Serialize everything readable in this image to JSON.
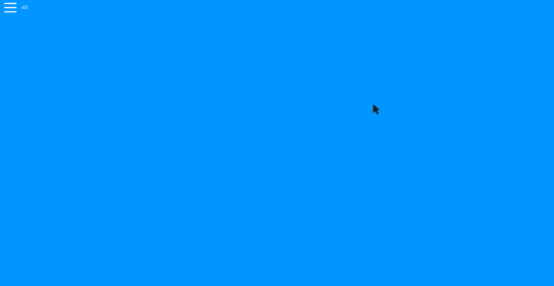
{
  "screen": {
    "background_color": "#0095FF"
  },
  "topbar": {
    "menu_icon": "hamburger-menu-icon",
    "label": "ab"
  },
  "cursor": {
    "icon": "mouse-pointer-icon",
    "color": "#1A1A1A"
  }
}
